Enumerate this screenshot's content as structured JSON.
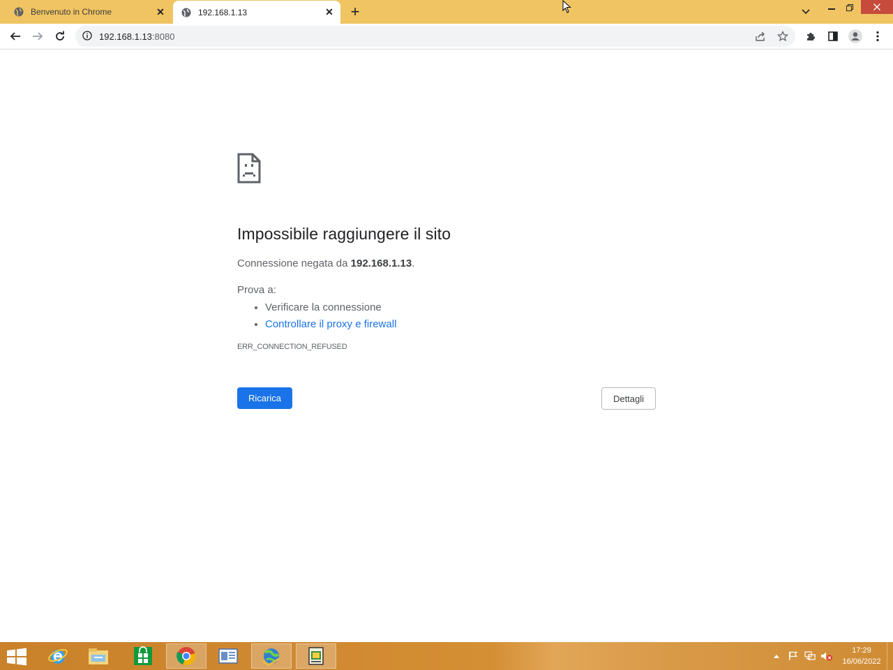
{
  "browser": {
    "tabs": [
      {
        "title": "Benvenuto in Chrome",
        "active": false
      },
      {
        "title": "192.168.1.13",
        "active": true
      }
    ],
    "new_tab_label": "+",
    "address": {
      "host": "192.168.1.13",
      "port": ":8080"
    }
  },
  "page": {
    "title": "Impossibile raggiungere il sito",
    "description_prefix": "Connessione negata da ",
    "description_host": "192.168.1.13",
    "description_suffix": ".",
    "try_label": "Prova a:",
    "suggestions": [
      {
        "text": "Verificare la connessione",
        "link": false
      },
      {
        "text": "Controllare il proxy e firewall",
        "link": true
      }
    ],
    "error_code": "ERR_CONNECTION_REFUSED",
    "reload_button": "Ricarica",
    "details_button": "Dettagli"
  },
  "taskbar": {
    "apps": [
      "internet-explorer-icon",
      "file-explorer-icon",
      "store-icon",
      "chrome-icon",
      "reader-icon",
      "network-globe-icon",
      "notepad-icon"
    ],
    "clock_time": "17:29",
    "clock_date": "16/06/2022"
  },
  "colors": {
    "tabstrip": "#f0c462",
    "primary_button": "#1a73e8",
    "link": "#1a73e8",
    "taskbar": "#d48e34",
    "window_close": "#c74b3d"
  }
}
